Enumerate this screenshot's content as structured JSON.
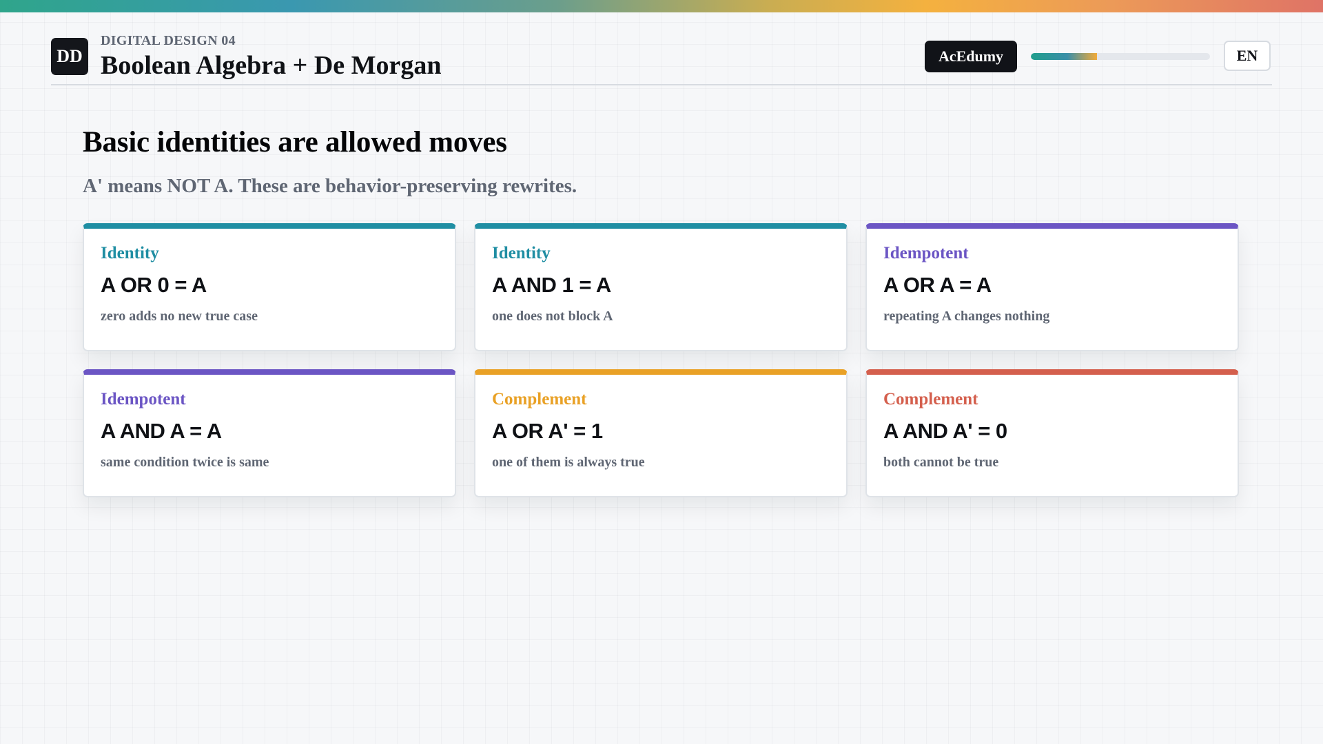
{
  "colors": {
    "teal": "#1f8ea3",
    "purple": "#6b55c4",
    "orange": "#e9a126",
    "red": "#d45f4d"
  },
  "header": {
    "logo_text": "DD",
    "eyebrow": "DIGITAL DESIGN 04",
    "title": "Boolean Algebra + De Morgan",
    "brand": "AcEdumy",
    "progress_fraction": 0.37,
    "language": "EN"
  },
  "slide": {
    "title": "Basic identities are allowed moves",
    "subtitle": "A' means NOT A. These are behavior-preserving rewrites."
  },
  "cards": [
    {
      "category": "Identity",
      "formula": "A OR 0 = A",
      "note": "zero adds no new true case",
      "color": "#1f8ea3"
    },
    {
      "category": "Identity",
      "formula": "A AND 1 = A",
      "note": "one does not block A",
      "color": "#1f8ea3"
    },
    {
      "category": "Idempotent",
      "formula": "A OR A = A",
      "note": "repeating A changes nothing",
      "color": "#6b55c4"
    },
    {
      "category": "Idempotent",
      "formula": "A AND A = A",
      "note": "same condition twice is same",
      "color": "#6b55c4"
    },
    {
      "category": "Complement",
      "formula": "A OR A' = 1",
      "note": "one of them is always true",
      "color": "#e9a126"
    },
    {
      "category": "Complement",
      "formula": "A AND A' = 0",
      "note": "both cannot be true",
      "color": "#d45f4d"
    }
  ]
}
